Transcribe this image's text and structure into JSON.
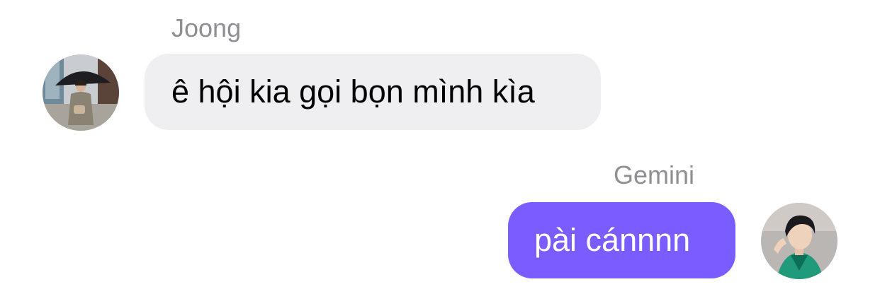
{
  "messages": [
    {
      "sender": "Joong",
      "text": "ê hội kia gọi bọn mình kìa",
      "direction": "incoming",
      "bubble_color": "#efeff1",
      "text_color": "#000000"
    },
    {
      "sender": "Gemini",
      "text": "pài cánnnn",
      "direction": "outgoing",
      "bubble_color": "#7b5cff",
      "text_color": "#ffffff"
    }
  ],
  "colors": {
    "sender_name": "#8e8e93",
    "background": "#ffffff"
  }
}
